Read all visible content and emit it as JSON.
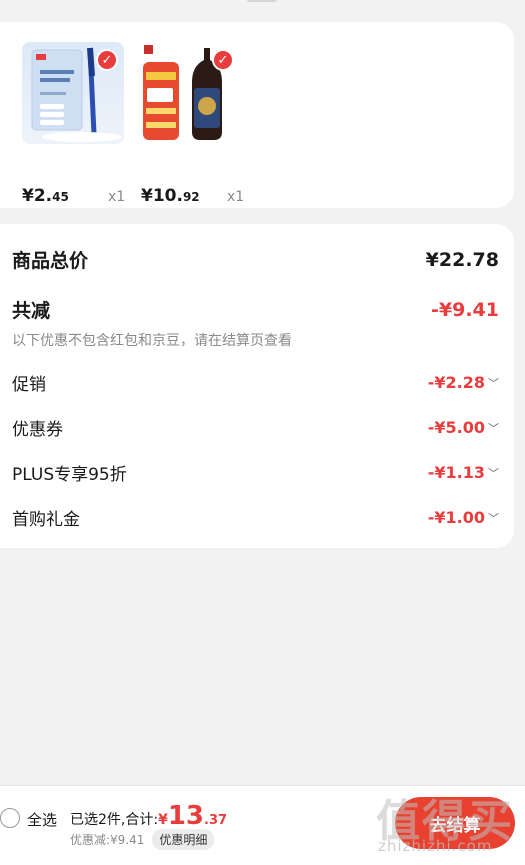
{
  "products": [
    {
      "price_main": "¥2.",
      "price_dec": "45",
      "qty": "x1",
      "name": "gel-pen"
    },
    {
      "price_main": "¥10.",
      "price_dec": "92",
      "qty": "x1",
      "name": "vinegar-bottle"
    }
  ],
  "product_img_text": {
    "pen_box": [
      "好写",
      "好用",
      "中性笔",
      "0.5mm"
    ],
    "vinegar_brand": "恒顺",
    "vinegar_price": "¥17.91"
  },
  "summary": {
    "total_label": "商品总价",
    "total_value": "¥22.78",
    "reduce_label": "共减",
    "reduce_value": "-¥9.41",
    "note": "以下优惠不包含红包和京豆，请在结算页查看",
    "items": [
      {
        "label": "促销",
        "value": "-¥2.28"
      },
      {
        "label": "优惠券",
        "value": "-¥5.00"
      },
      {
        "label": "PLUS专享95折",
        "value": "-¥1.13"
      },
      {
        "label": "首购礼金",
        "value": "-¥1.00"
      }
    ]
  },
  "bottom": {
    "select_all": "全选",
    "selected_text": "已选2件,合计:",
    "total_sym": "¥",
    "total_int": "13",
    "total_dec": ".37",
    "discount_text": "优惠减:¥9.41",
    "discount_detail": "优惠明细",
    "checkout": "去结算"
  },
  "watermark": {
    "big": "值得买",
    "small": "zhizhizhi.com"
  },
  "colors": {
    "accent": "#e93d3d",
    "checkout": "#e9412f"
  }
}
